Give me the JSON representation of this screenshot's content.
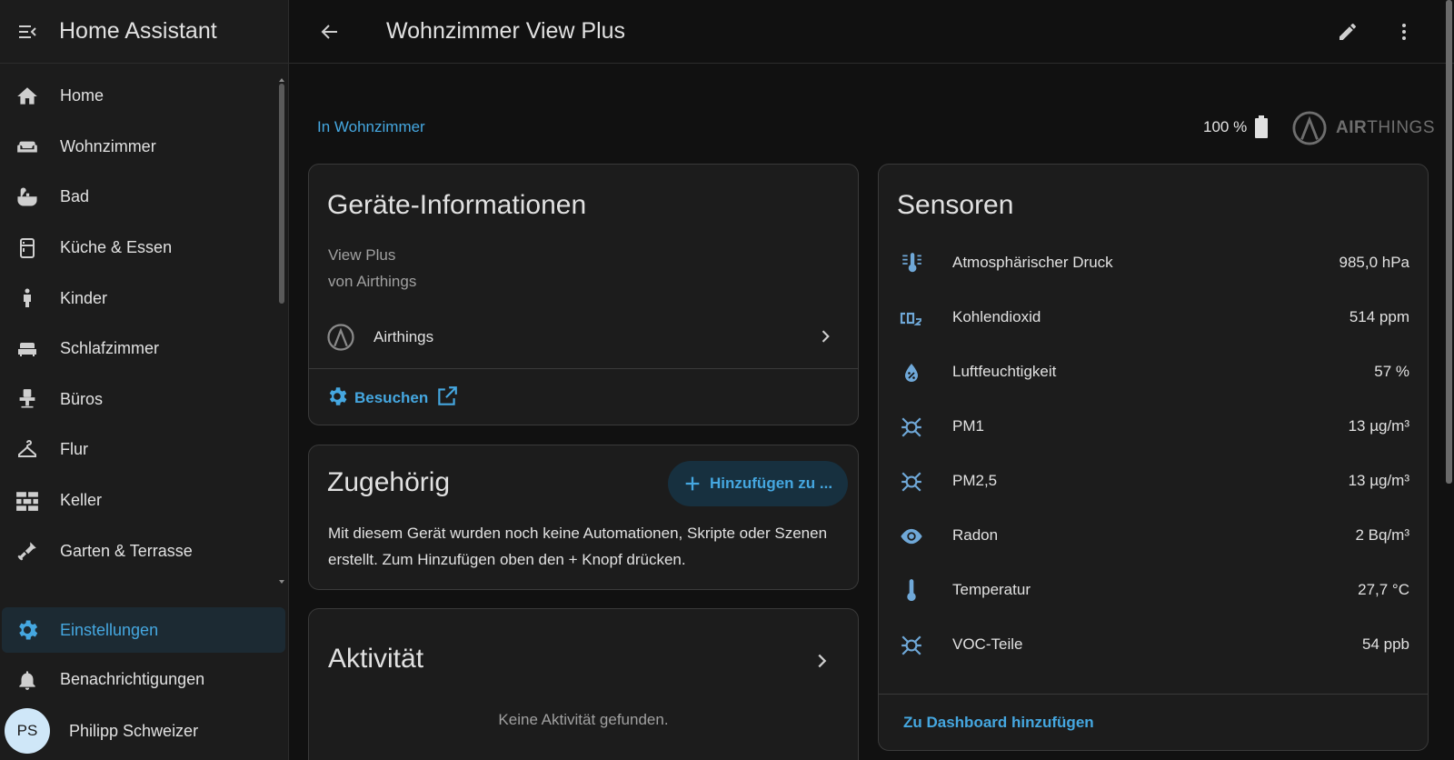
{
  "app": {
    "title": "Home Assistant"
  },
  "sidebar": {
    "items": [
      {
        "label": "Home",
        "icon": "home-icon"
      },
      {
        "label": "Wohnzimmer",
        "icon": "sofa-icon"
      },
      {
        "label": "Bad",
        "icon": "bathtub-icon"
      },
      {
        "label": "Küche & Essen",
        "icon": "fridge-icon"
      },
      {
        "label": "Kinder",
        "icon": "child-icon"
      },
      {
        "label": "Schlafzimmer",
        "icon": "bed-icon"
      },
      {
        "label": "Büros",
        "icon": "office-chair-icon"
      },
      {
        "label": "Flur",
        "icon": "hanger-icon"
      },
      {
        "label": "Keller",
        "icon": "wall-icon"
      },
      {
        "label": "Garten & Terrasse",
        "icon": "shovel-icon"
      }
    ],
    "settings": {
      "label": "Einstellungen",
      "icon": "cog-icon"
    },
    "notifications": {
      "label": "Benachrichtigungen",
      "icon": "bell-icon"
    },
    "user": {
      "initials": "PS",
      "name": "Philipp Schweizer"
    }
  },
  "header": {
    "title": "Wohnzimmer View Plus"
  },
  "device": {
    "area_link": "In Wohnzimmer",
    "battery": "100 %",
    "brand_bold": "AIR",
    "brand_rest": "THINGS"
  },
  "info_card": {
    "title": "Geräte-Informationen",
    "model": "View Plus",
    "manufacturer": "von Airthings",
    "integration": "Airthings",
    "visit_label": "Besuchen"
  },
  "related_card": {
    "title": "Zugehörig",
    "add_label": "Hinzufügen zu ...",
    "text": "Mit diesem Gerät wurden noch keine Automationen, Skripte oder Szenen erstellt. Zum Hinzufügen oben den + Knopf drücken."
  },
  "activity_card": {
    "title": "Aktivität",
    "empty": "Keine Aktivität gefunden."
  },
  "sensors_card": {
    "title": "Sensoren",
    "rows": [
      {
        "name": "Atmosphärischer Druck",
        "value": "985,0 hPa",
        "icon": "thermometer-lines-icon"
      },
      {
        "name": "Kohlendioxid",
        "value": "514 ppm",
        "icon": "co2-icon"
      },
      {
        "name": "Luftfeuchtigkeit",
        "value": "57 %",
        "icon": "water-percent-icon"
      },
      {
        "name": "PM1",
        "value": "13 µg/m³",
        "icon": "particles-icon"
      },
      {
        "name": "PM2,5",
        "value": "13 µg/m³",
        "icon": "particles-icon"
      },
      {
        "name": "Radon",
        "value": "2 Bq/m³",
        "icon": "eye-icon"
      },
      {
        "name": "Temperatur",
        "value": "27,7 °C",
        "icon": "thermometer-icon"
      },
      {
        "name": "VOC-Teile",
        "value": "54 ppb",
        "icon": "particles-icon"
      }
    ],
    "dashboard_label": "Zu Dashboard hinzufügen"
  },
  "colors": {
    "accent": "#45a7e0",
    "sensor_icon": "#6fa8d8",
    "background": "#111111",
    "card": "#1c1c1c"
  }
}
